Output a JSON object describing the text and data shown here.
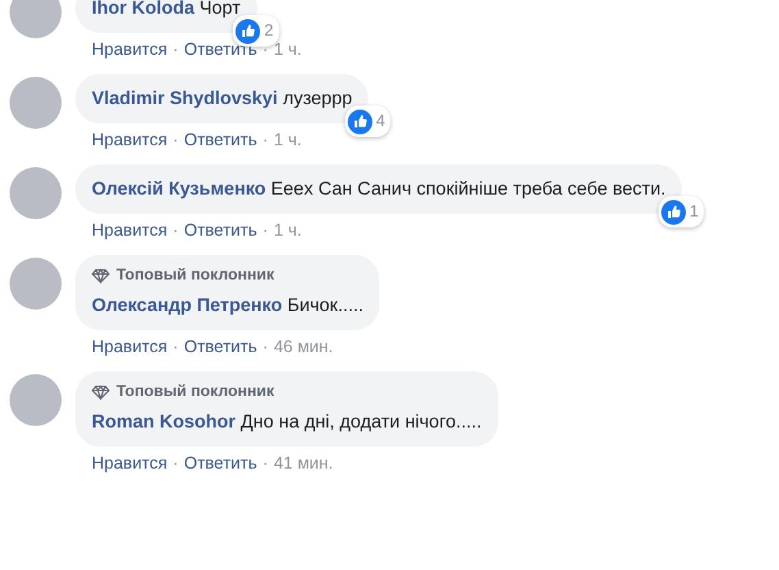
{
  "comments": [
    {
      "author": "Ihor Koloda",
      "text": "Чорт",
      "reactions": {
        "count": "2"
      },
      "actions": [
        {
          "kind": "link",
          "label": "Нравится"
        },
        {
          "kind": "separator",
          "label": "·"
        },
        {
          "kind": "link",
          "label": "Ответить"
        },
        {
          "kind": "separator",
          "label": "·"
        },
        {
          "kind": "time",
          "label": "1 ч."
        }
      ]
    },
    {
      "author": "Vladimir Shydlovskyi",
      "text": "лузеррр",
      "reactions": {
        "count": "4"
      },
      "actions": [
        {
          "kind": "link",
          "label": "Нравится"
        },
        {
          "kind": "separator",
          "label": "·"
        },
        {
          "kind": "link",
          "label": "Ответить"
        },
        {
          "kind": "separator",
          "label": "·"
        },
        {
          "kind": "time",
          "label": "1 ч."
        }
      ]
    },
    {
      "author": "Олексій Кузьменко",
      "text": "Еeex Сан Санич спокійніше треба себе вести.",
      "reactions": {
        "count": "1"
      },
      "actions": [
        {
          "kind": "link",
          "label": "Нравится"
        },
        {
          "kind": "separator",
          "label": "·"
        },
        {
          "kind": "link",
          "label": "Ответить"
        },
        {
          "kind": "separator",
          "label": "·"
        },
        {
          "kind": "time",
          "label": "1 ч."
        }
      ]
    },
    {
      "badge": "Топовый поклонник",
      "author": "Олександр Петренко",
      "text": "Бичок.....",
      "actions": [
        {
          "kind": "link",
          "label": "Нравится"
        },
        {
          "kind": "separator",
          "label": "·"
        },
        {
          "kind": "link",
          "label": "Ответить"
        },
        {
          "kind": "separator",
          "label": "·"
        },
        {
          "kind": "time",
          "label": "46 мин."
        }
      ]
    },
    {
      "badge": "Топовый поклонник",
      "author": "Roman Kosohor",
      "text": "Дно на дні, додати нічого.....",
      "actions": [
        {
          "kind": "link",
          "label": "Нравится"
        },
        {
          "kind": "separator",
          "label": "·"
        },
        {
          "kind": "link",
          "label": "Ответить"
        },
        {
          "kind": "separator",
          "label": "·"
        },
        {
          "kind": "time",
          "label": "41 мин."
        }
      ]
    }
  ]
}
